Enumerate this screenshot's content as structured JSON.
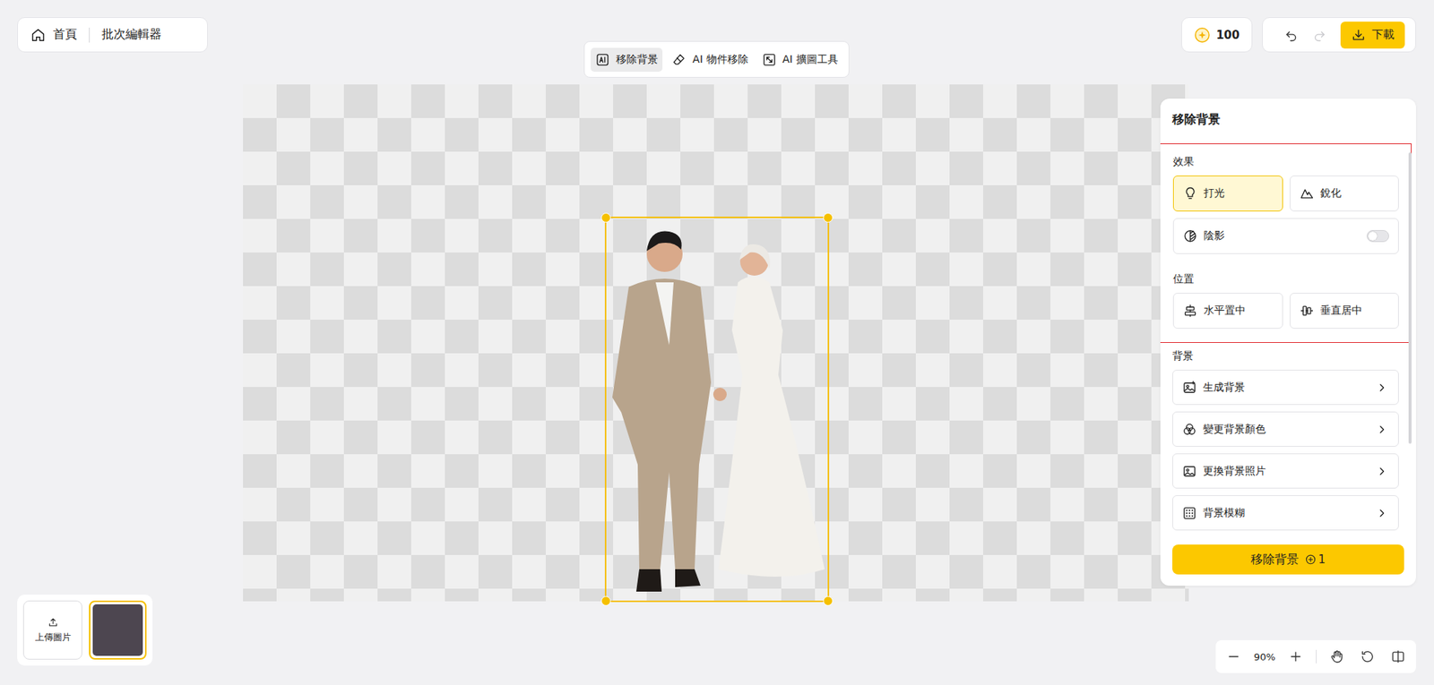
{
  "nav": {
    "home": "首頁",
    "title": "批次編輯器"
  },
  "tools": [
    {
      "label": "移除背景",
      "selected": true
    },
    {
      "label": "AI 物件移除",
      "selected": false
    },
    {
      "label": "AI 擴圖工具",
      "selected": false
    }
  ],
  "credits": "100",
  "history": {
    "undo_disabled": false,
    "redo_disabled": true
  },
  "download": "下載",
  "canvas": {
    "image_selected": true
  },
  "panel": {
    "title": "移除背景",
    "effects": {
      "label": "效果",
      "options": [
        {
          "label": "打光",
          "selected": true
        },
        {
          "label": "銳化",
          "selected": false
        }
      ],
      "shadow": {
        "label": "陰影",
        "on": false
      }
    },
    "position": {
      "label": "位置",
      "options": [
        {
          "label": "水平置中"
        },
        {
          "label": "垂直居中"
        }
      ]
    },
    "background": {
      "label": "背景",
      "items": [
        "生成背景",
        "變更背景顏色",
        "更換背景照片",
        "背景模糊"
      ]
    },
    "action": {
      "label": "移除背景",
      "cost": "1"
    }
  },
  "uploads": {
    "label": "上傳圖片",
    "thumbnails": [
      {
        "selected": true
      }
    ]
  },
  "zoom": {
    "level": "90%"
  }
}
